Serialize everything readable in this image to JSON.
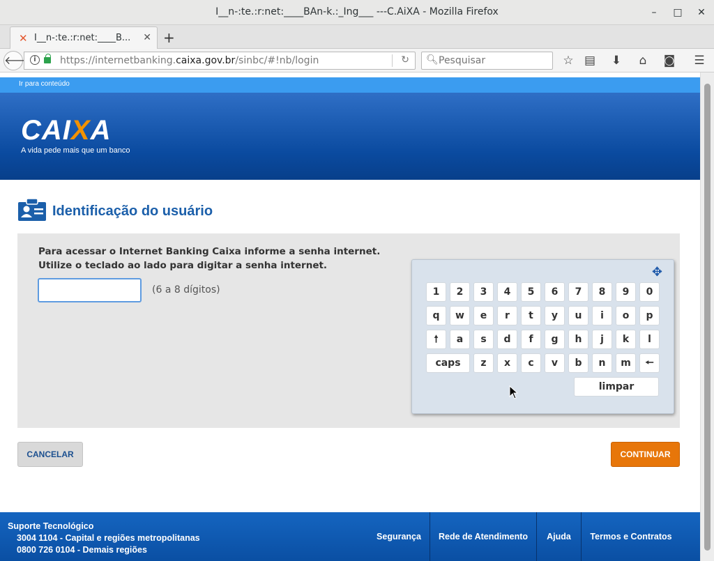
{
  "window": {
    "title": "I__n-:te.:r:net:____BAn-k.:_Ing___ ---C.AiXA - Mozilla Firefox",
    "minimize": "–",
    "maximize": "□",
    "close": "✕"
  },
  "tab": {
    "title": "I__n-:te.:r:net:____B...",
    "close": "✕",
    "new_tab": "+"
  },
  "navbar": {
    "url_prefix": "https://internetbanking.",
    "url_domain": "caixa.gov.br",
    "url_suffix": "/sinbc/#!nb/login",
    "search_placeholder": "Pesquisar"
  },
  "page": {
    "skip_link": "Ir para conteúdo",
    "logo": {
      "word_a": "CAI",
      "word_x": "X",
      "word_b": "A",
      "tagline": "A vida pede mais que um banco"
    },
    "section_title": "Identificação do usuário",
    "instructions": [
      "Para acessar o Internet Banking Caixa informe a senha internet.",
      "Utilize o teclado ao lado para digitar a senha internet."
    ],
    "password_value": "",
    "password_hint": "(6 a 8 dígitos)",
    "keypad": {
      "row1": [
        "1",
        "2",
        "3",
        "4",
        "5",
        "6",
        "7",
        "8",
        "9",
        "0"
      ],
      "row2": [
        "q",
        "w",
        "e",
        "r",
        "t",
        "y",
        "u",
        "i",
        "o",
        "p"
      ],
      "row3": [
        "🠕",
        "a",
        "s",
        "d",
        "f",
        "g",
        "h",
        "j",
        "k",
        "l"
      ],
      "row4": [
        "caps",
        "z",
        "x",
        "c",
        "v",
        "b",
        "n",
        "m",
        "🠔"
      ],
      "clear": "limpar"
    },
    "cancel_label": "CANCELAR",
    "continue_label": "CONTINUAR",
    "footer": {
      "support_title": "Suporte Tecnológico",
      "support_line1": "3004 1104 - Capital e regiões metropolitanas",
      "support_line2": "0800 726 0104 - Demais regiões",
      "links": [
        "Segurança",
        "Rede de Atendimento",
        "Ajuda",
        "Termos e Contratos"
      ]
    }
  },
  "colors": {
    "brand_blue": "#0a4a9f",
    "accent_orange": "#e7760a",
    "skip_bar": "#3b9cf0"
  }
}
